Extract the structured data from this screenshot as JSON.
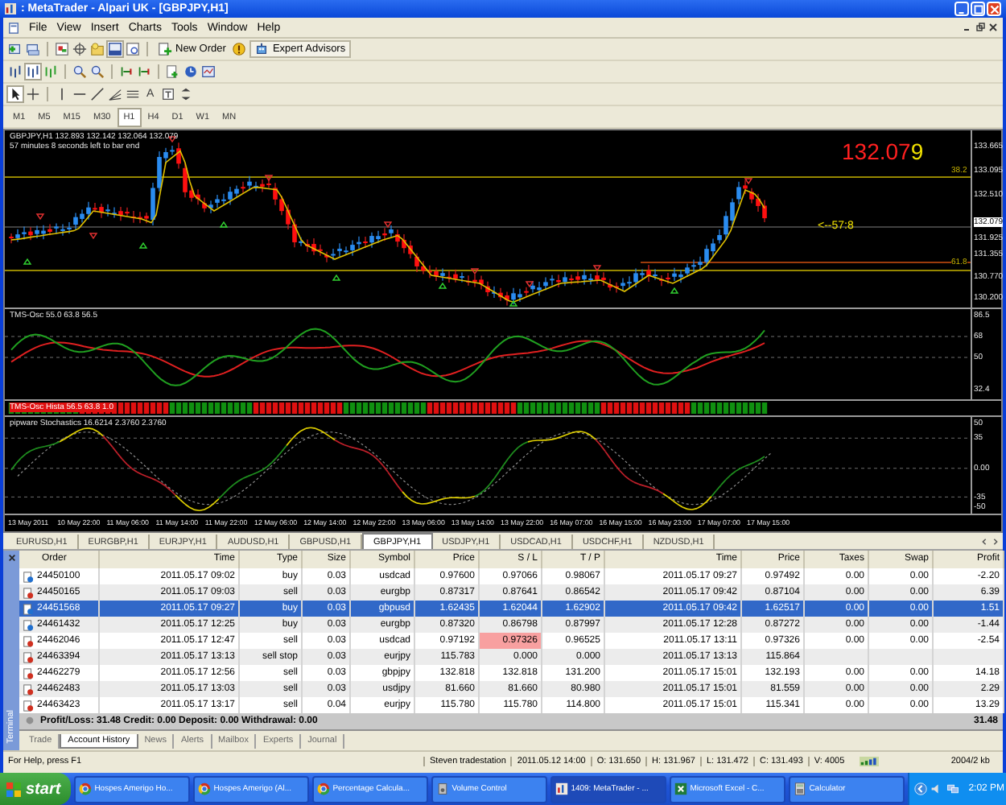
{
  "window": {
    "title": ": MetaTrader - Alpari UK - [GBPJPY,H1]"
  },
  "menu": [
    "File",
    "View",
    "Insert",
    "Charts",
    "Tools",
    "Window",
    "Help"
  ],
  "toolbar": {
    "new_order": "New Order",
    "expert_advisors": "Expert Advisors",
    "text_tool": "A"
  },
  "timeframes": [
    {
      "label": "M1",
      "selected": false
    },
    {
      "label": "M5",
      "selected": false
    },
    {
      "label": "M15",
      "selected": false
    },
    {
      "label": "M30",
      "selected": false
    },
    {
      "label": "H1",
      "selected": true
    },
    {
      "label": "H4",
      "selected": false
    },
    {
      "label": "D1",
      "selected": false
    },
    {
      "label": "W1",
      "selected": false
    },
    {
      "label": "MN",
      "selected": false
    }
  ],
  "chart": {
    "symbol_line": "GBPJPY,H1  132.893 132.142 132.064 132.079",
    "timer_line": "57 minutes 8 seconds left to bar end",
    "price_big": "132.07",
    "price_last_digit": "9",
    "countdown": "<--57:8",
    "levels": [
      "38.2",
      "61.8"
    ],
    "price_axis": [
      "133.665",
      "133.095",
      "132.510",
      "131.925",
      "131.355",
      "130.770",
      "130.200"
    ],
    "current_price": "132.079"
  },
  "oscillator": {
    "title": "TMS-Osc 55.0 63.8 56.5",
    "axis": [
      "86.5",
      "68",
      "50",
      "32.4"
    ]
  },
  "histogram": {
    "title": "TMS-Osc Hista 56.5 63.8 1.0"
  },
  "stochastic": {
    "title": "pipware Stochastics 16.6214 2.3760 2.3760",
    "axis": [
      "50",
      "35",
      "0.00",
      "-35",
      "-50"
    ]
  },
  "time_axis": [
    "13 May 2011",
    "10 May 22:00",
    "11 May 06:00",
    "11 May 14:00",
    "11 May 22:00",
    "12 May 06:00",
    "12 May 14:00",
    "12 May 22:00",
    "13 May 06:00",
    "13 May 14:00",
    "13 May 22:00",
    "16 May 07:00",
    "16 May 15:00",
    "16 May 23:00",
    "17 May 07:00",
    "17 May 15:00"
  ],
  "chart_tabs": [
    {
      "label": "EURUSD,H1",
      "selected": false
    },
    {
      "label": "EURGBP,H1",
      "selected": false
    },
    {
      "label": "EURJPY,H1",
      "selected": false
    },
    {
      "label": "AUDUSD,H1",
      "selected": false
    },
    {
      "label": "GBPUSD,H1",
      "selected": false
    },
    {
      "label": "GBPJPY,H1",
      "selected": true
    },
    {
      "label": "USDJPY,H1",
      "selected": false
    },
    {
      "label": "USDCAD,H1",
      "selected": false
    },
    {
      "label": "USDCHF,H1",
      "selected": false
    },
    {
      "label": "NZDUSD,H1",
      "selected": false
    }
  ],
  "table": {
    "columns": [
      "Order",
      "Time",
      "Type",
      "Size",
      "Symbol",
      "Price",
      "S / L",
      "T / P",
      "Time",
      "Price",
      "Taxes",
      "Swap",
      "Profit"
    ],
    "rows": [
      {
        "kind": "buy",
        "selected": false,
        "sl_hit": false,
        "cells": [
          "24450100",
          "2011.05.17 09:02",
          "buy",
          "0.03",
          "usdcad",
          "0.97600",
          "0.97066",
          "0.98067",
          "2011.05.17 09:27",
          "0.97492",
          "0.00",
          "0.00",
          "-2.20"
        ]
      },
      {
        "kind": "sell",
        "selected": false,
        "sl_hit": false,
        "cells": [
          "24450165",
          "2011.05.17 09:03",
          "sell",
          "0.03",
          "eurgbp",
          "0.87317",
          "0.87641",
          "0.86542",
          "2011.05.17 09:42",
          "0.87104",
          "0.00",
          "0.00",
          "6.39"
        ]
      },
      {
        "kind": "buy",
        "selected": true,
        "sl_hit": false,
        "cells": [
          "24451568",
          "2011.05.17 09:27",
          "buy",
          "0.03",
          "gbpusd",
          "1.62435",
          "1.62044",
          "1.62902",
          "2011.05.17 09:42",
          "1.62517",
          "0.00",
          "0.00",
          "1.51"
        ]
      },
      {
        "kind": "buy",
        "selected": false,
        "sl_hit": false,
        "cells": [
          "24461432",
          "2011.05.17 12:25",
          "buy",
          "0.03",
          "eurgbp",
          "0.87320",
          "0.86798",
          "0.87997",
          "2011.05.17 12:28",
          "0.87272",
          "0.00",
          "0.00",
          "-1.44"
        ]
      },
      {
        "kind": "sell",
        "selected": false,
        "sl_hit": true,
        "cells": [
          "24462046",
          "2011.05.17 12:47",
          "sell",
          "0.03",
          "usdcad",
          "0.97192",
          "0.97326",
          "0.96525",
          "2011.05.17 13:11",
          "0.97326",
          "0.00",
          "0.00",
          "-2.54"
        ]
      },
      {
        "kind": "sell",
        "selected": false,
        "sl_hit": false,
        "cells": [
          "24463394",
          "2011.05.17 13:13",
          "sell stop",
          "0.03",
          "eurjpy",
          "115.783",
          "0.000",
          "0.000",
          "2011.05.17 13:13",
          "115.864"
        ]
      },
      {
        "kind": "sell",
        "selected": false,
        "sl_hit": false,
        "cells": [
          "24462279",
          "2011.05.17 12:56",
          "sell",
          "0.03",
          "gbpjpy",
          "132.818",
          "132.818",
          "131.200",
          "2011.05.17 15:01",
          "132.193",
          "0.00",
          "0.00",
          "14.18"
        ]
      },
      {
        "kind": "sell",
        "selected": false,
        "sl_hit": false,
        "cells": [
          "24462483",
          "2011.05.17 13:03",
          "sell",
          "0.03",
          "usdjpy",
          "81.660",
          "81.660",
          "80.980",
          "2011.05.17 15:01",
          "81.559",
          "0.00",
          "0.00",
          "2.29"
        ]
      },
      {
        "kind": "sell",
        "selected": false,
        "sl_hit": false,
        "cells": [
          "24463423",
          "2011.05.17 13:17",
          "sell",
          "0.04",
          "eurjpy",
          "115.780",
          "115.780",
          "114.800",
          "2011.05.17 15:01",
          "115.341",
          "0.00",
          "0.00",
          "13.29"
        ]
      }
    ],
    "summary": {
      "text": "Profit/Loss: 31.48  Credit: 0.00  Deposit: 0.00  Withdrawal: 0.00",
      "total": "31.48"
    }
  },
  "terminal_label": "Terminal",
  "terminal_tabs": [
    {
      "label": "Trade",
      "selected": false
    },
    {
      "label": "Account History",
      "selected": true
    },
    {
      "label": "News",
      "selected": false
    },
    {
      "label": "Alerts",
      "selected": false
    },
    {
      "label": "Mailbox",
      "selected": false
    },
    {
      "label": "Experts",
      "selected": false
    },
    {
      "label": "Journal",
      "selected": false
    }
  ],
  "status_bar": {
    "help": "For Help, press F1",
    "fields": [
      "Steven tradestation",
      "2011.05.12 14:00",
      "O: 131.650",
      "H: 131.967",
      "L: 131.472",
      "C: 131.493",
      "V: 4005"
    ],
    "traffic": "2004/2 kb"
  },
  "taskbar": {
    "start": "start",
    "items": [
      {
        "label": "Hospes Amerigo Ho...",
        "kind": "browser",
        "selected": false
      },
      {
        "label": "Hospes Amerigo (Al...",
        "kind": "browser",
        "selected": false
      },
      {
        "label": "Percentage Calcula...",
        "kind": "browser",
        "selected": false
      },
      {
        "label": "Volume Control",
        "kind": "volume",
        "selected": false
      },
      {
        "label": "1409: MetaTrader - ...",
        "kind": "metatrader",
        "selected": true
      },
      {
        "label": "Microsoft Excel - C...",
        "kind": "excel",
        "selected": false
      },
      {
        "label": "Calculator",
        "kind": "calculator",
        "selected": false
      }
    ],
    "clock": "2:02 PM"
  }
}
